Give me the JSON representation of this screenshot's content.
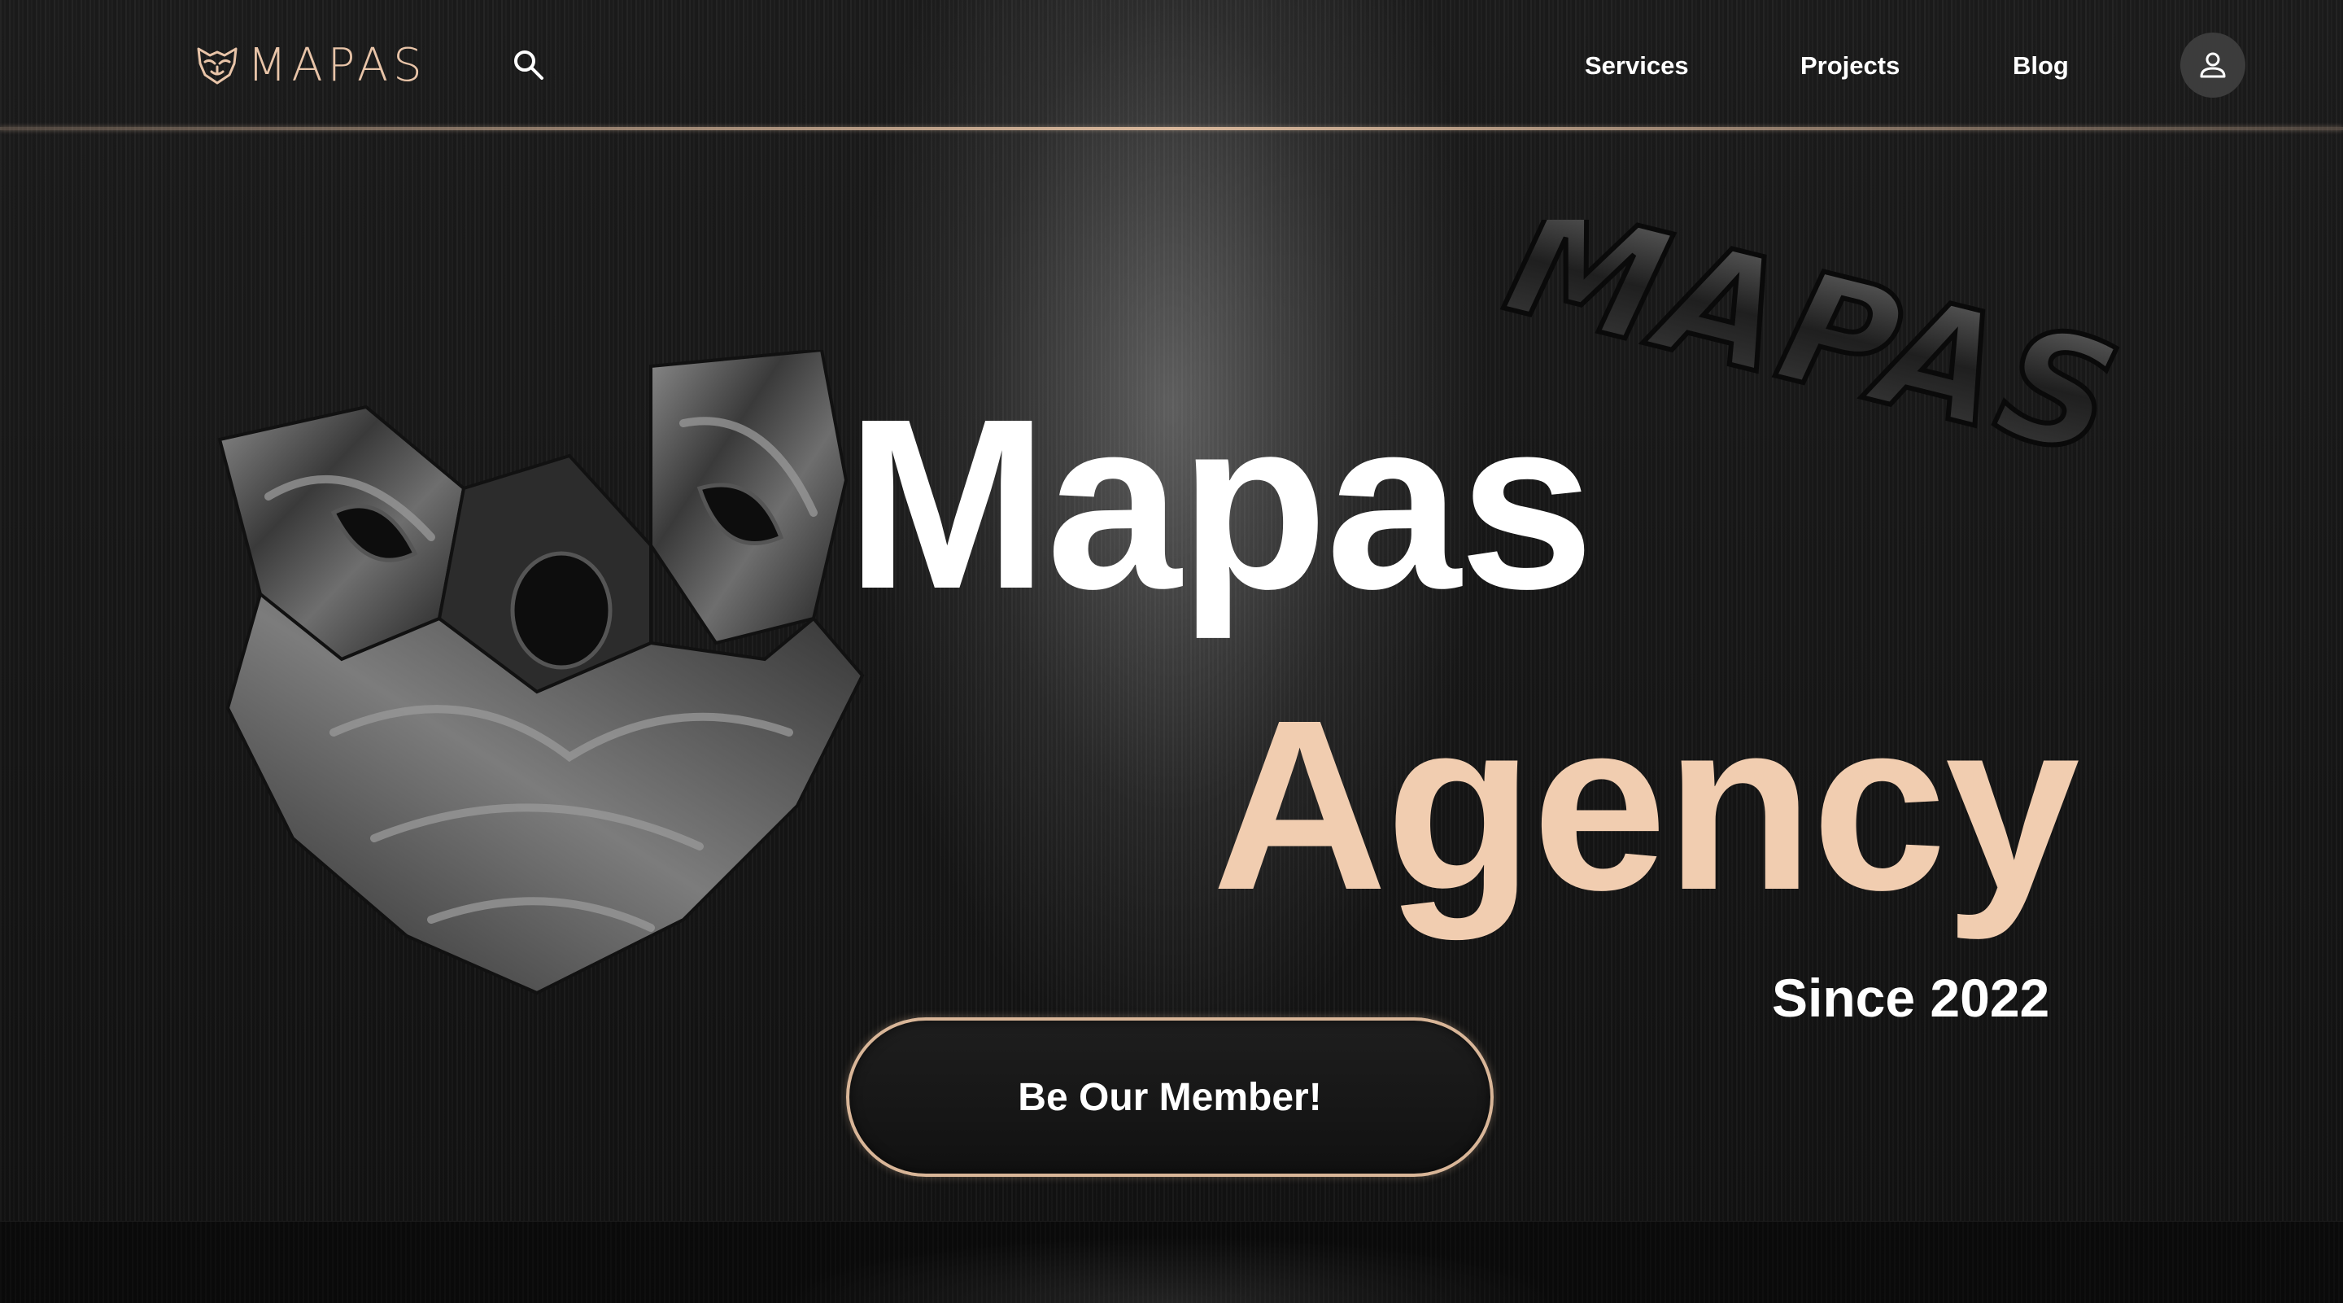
{
  "brand": {
    "name": "MAPAS",
    "logo_icon": "tiger-mask-icon",
    "accent_color": "#e8c4a8"
  },
  "header": {
    "search_icon": "search-icon",
    "nav": [
      {
        "label": "Services"
      },
      {
        "label": "Projects"
      },
      {
        "label": "Blog"
      }
    ],
    "account_icon": "user-icon"
  },
  "hero": {
    "title_line1": "Mapas",
    "title_line2": "Agency",
    "since": "Since 2022",
    "cta_label": "Be Our Member!",
    "decor_word": "MAPAS",
    "title_line2_color": "#f1cdb0"
  }
}
